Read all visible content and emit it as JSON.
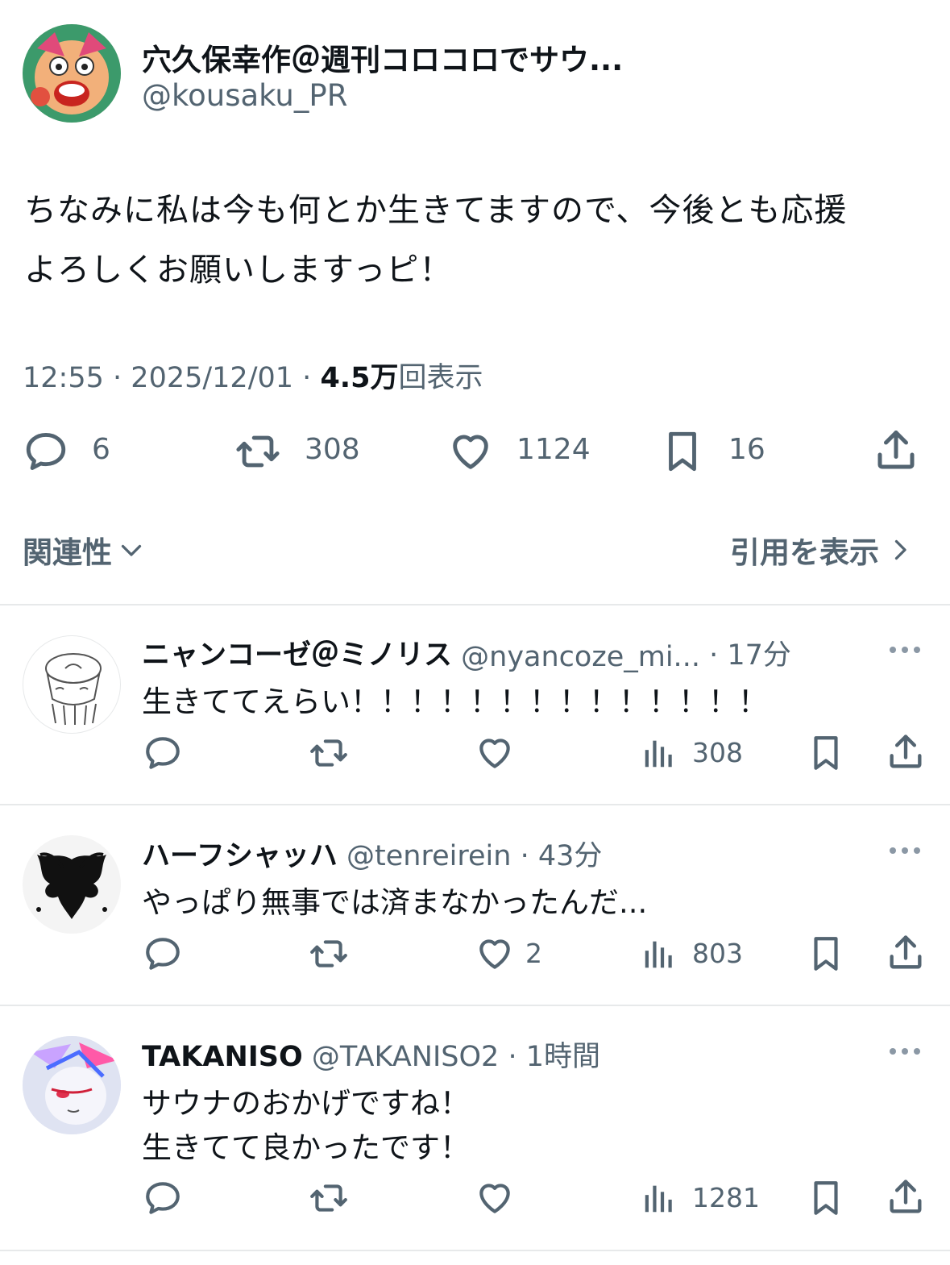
{
  "tweet": {
    "author_name": "穴久保幸作＠週刊コロコロでサウ...",
    "author_handle": "@kousaku_PR",
    "text_line1": "ちなみに私は今も何とか生きてますので、今後とも応援",
    "text_line2": "よろしくお願いしますっピ！",
    "time": "12:55",
    "dot": "·",
    "date": "2025/12/01",
    "views_count": "4.5万",
    "views_label": "回表示",
    "stats": {
      "replies": "6",
      "retweets": "308",
      "likes": "1124",
      "bookmarks": "16"
    }
  },
  "sort": {
    "label": "関連性",
    "quotes_label": "引用を表示"
  },
  "replies": [
    {
      "name": "ニャンコーゼ＠ミノリス",
      "handle": "@nyancoze_mi...",
      "time": "· 17分",
      "lines": [
        "生きててえらい！！！！！！！！！！！！！！"
      ],
      "likes": "",
      "views": "308"
    },
    {
      "name": "ハーフシャッハ",
      "handle": "@tenreirein",
      "time": "· 43分",
      "lines": [
        "やっぱり無事では済まなかったんだ..."
      ],
      "likes": "2",
      "views": "803"
    },
    {
      "name": "TAKANISO",
      "handle": "@TAKANISO2",
      "time": "· 1時間",
      "lines": [
        "サウナのおかげですね！",
        "生きてて良かったです！"
      ],
      "likes": "",
      "views": "1281"
    }
  ],
  "icons": [
    "reply-icon",
    "retweet-icon",
    "like-icon",
    "bookmark-icon",
    "share-icon",
    "views-icon",
    "more-icon",
    "chevron-down-icon",
    "chevron-right-icon"
  ],
  "colors": {
    "text": "#0f1419",
    "secondary": "#536471",
    "divider": "#e7e9ea"
  }
}
